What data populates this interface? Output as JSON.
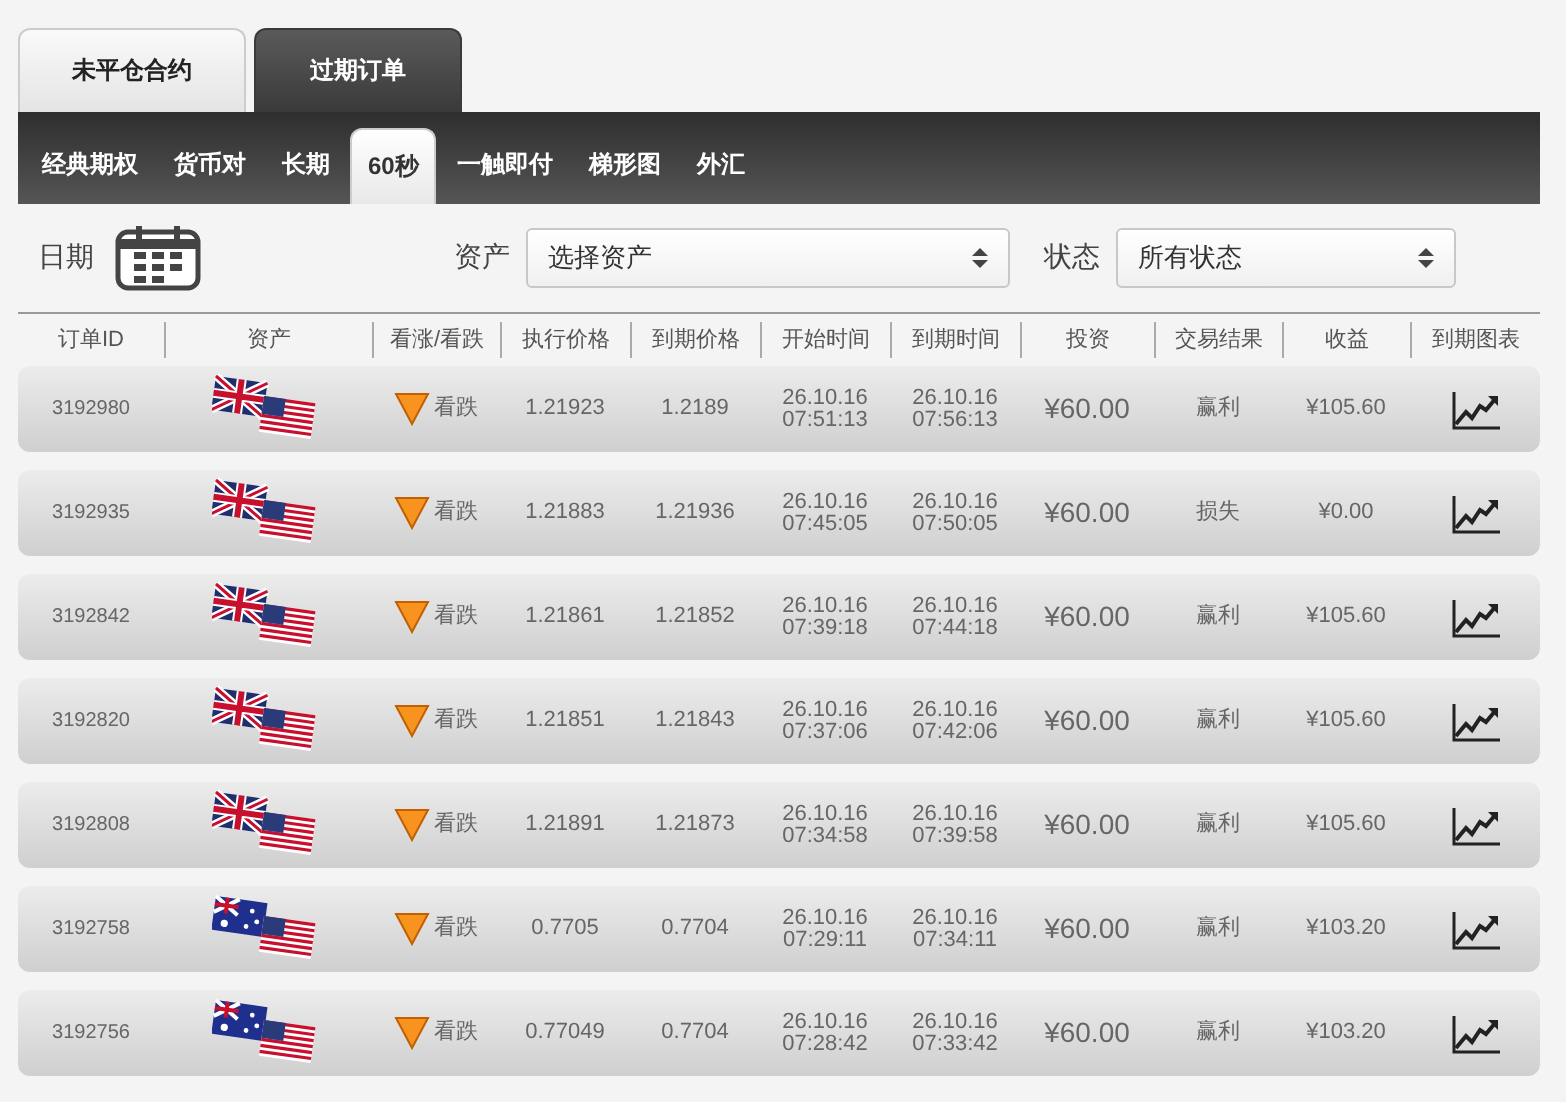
{
  "main_tabs": [
    {
      "label": "未平仓合约",
      "selected": false
    },
    {
      "label": "过期订单",
      "selected": true
    }
  ],
  "sub_tabs": [
    {
      "label": "经典期权",
      "selected": false
    },
    {
      "label": "货币对",
      "selected": false
    },
    {
      "label": "长期",
      "selected": false
    },
    {
      "label": "60秒",
      "selected": true
    },
    {
      "label": "一触即付",
      "selected": false
    },
    {
      "label": "梯形图",
      "selected": false
    },
    {
      "label": "外汇",
      "selected": false
    }
  ],
  "filters": {
    "date_label": "日期",
    "asset_label": "资产",
    "asset_value": "选择资产",
    "status_label": "状态",
    "status_value": "所有状态"
  },
  "table": {
    "columns": [
      "订单ID",
      "资产",
      "看涨/看跌",
      "执行价格",
      "到期价格",
      "开始时间",
      "到期时间",
      "投资",
      "交易结果",
      "收益",
      "到期图表"
    ],
    "rows": [
      {
        "id": "3192980",
        "asset": {
          "kind": "uk-us"
        },
        "direction": {
          "kind": "down",
          "label": "看跌"
        },
        "strike": "1.21923",
        "expiry_price": "1.2189",
        "start_date": "26.10.16",
        "start_time": "07:51:13",
        "end_date": "26.10.16",
        "end_time": "07:56:13",
        "investment": "¥60.00",
        "result": "赢利",
        "profit": "¥105.60"
      },
      {
        "id": "3192935",
        "asset": {
          "kind": "uk-us"
        },
        "direction": {
          "kind": "down",
          "label": "看跌"
        },
        "strike": "1.21883",
        "expiry_price": "1.21936",
        "start_date": "26.10.16",
        "start_time": "07:45:05",
        "end_date": "26.10.16",
        "end_time": "07:50:05",
        "investment": "¥60.00",
        "result": "损失",
        "profit": "¥0.00"
      },
      {
        "id": "3192842",
        "asset": {
          "kind": "uk-us"
        },
        "direction": {
          "kind": "down",
          "label": "看跌"
        },
        "strike": "1.21861",
        "expiry_price": "1.21852",
        "start_date": "26.10.16",
        "start_time": "07:39:18",
        "end_date": "26.10.16",
        "end_time": "07:44:18",
        "investment": "¥60.00",
        "result": "赢利",
        "profit": "¥105.60"
      },
      {
        "id": "3192820",
        "asset": {
          "kind": "uk-us"
        },
        "direction": {
          "kind": "down",
          "label": "看跌"
        },
        "strike": "1.21851",
        "expiry_price": "1.21843",
        "start_date": "26.10.16",
        "start_time": "07:37:06",
        "end_date": "26.10.16",
        "end_time": "07:42:06",
        "investment": "¥60.00",
        "result": "赢利",
        "profit": "¥105.60"
      },
      {
        "id": "3192808",
        "asset": {
          "kind": "uk-us"
        },
        "direction": {
          "kind": "down",
          "label": "看跌"
        },
        "strike": "1.21891",
        "expiry_price": "1.21873",
        "start_date": "26.10.16",
        "start_time": "07:34:58",
        "end_date": "26.10.16",
        "end_time": "07:39:58",
        "investment": "¥60.00",
        "result": "赢利",
        "profit": "¥105.60"
      },
      {
        "id": "3192758",
        "asset": {
          "kind": "au-us"
        },
        "direction": {
          "kind": "down",
          "label": "看跌"
        },
        "strike": "0.7705",
        "expiry_price": "0.7704",
        "start_date": "26.10.16",
        "start_time": "07:29:11",
        "end_date": "26.10.16",
        "end_time": "07:34:11",
        "investment": "¥60.00",
        "result": "赢利",
        "profit": "¥103.20"
      },
      {
        "id": "3192756",
        "asset": {
          "kind": "au-us"
        },
        "direction": {
          "kind": "down",
          "label": "看跌"
        },
        "strike": "0.77049",
        "expiry_price": "0.7704",
        "start_date": "26.10.16",
        "start_time": "07:28:42",
        "end_date": "26.10.16",
        "end_time": "07:33:42",
        "investment": "¥60.00",
        "result": "赢利",
        "profit": "¥103.20"
      }
    ]
  }
}
